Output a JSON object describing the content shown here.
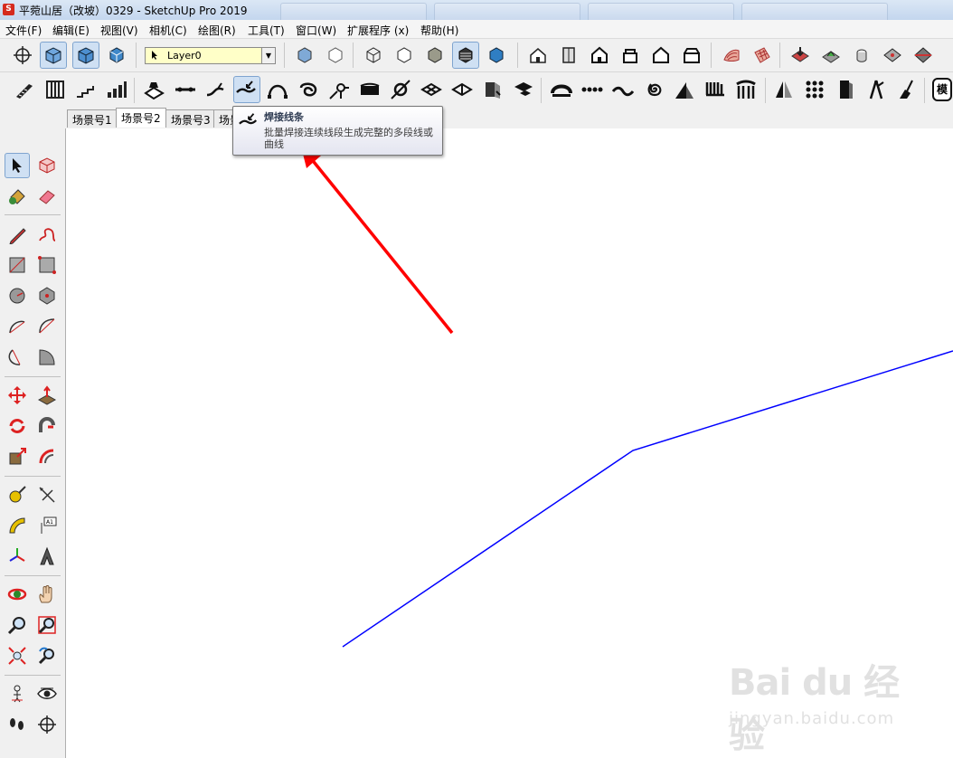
{
  "window": {
    "title": "平菀山居（改坡）0329 - SketchUp Pro 2019"
  },
  "menu": [
    "文件(F)",
    "编辑(E)",
    "视图(V)",
    "相机(C)",
    "绘图(R)",
    "工具(T)",
    "窗口(W)",
    "扩展程序 (x)",
    "帮助(H)"
  ],
  "layer": {
    "current": "Layer0"
  },
  "scene_tabs": [
    "场景号1",
    "场景号2",
    "场景号3",
    "场景"
  ],
  "active_scene_tab": "场景号2",
  "tooltip": {
    "title": "焊接线条",
    "description": "批量焊接连续线段生成完整的多段线或曲线"
  },
  "model_button_label": "模",
  "watermark": {
    "logo": "Bai du 经验",
    "url": "jingyan.baidu.com"
  },
  "colors": {
    "line": "#0000ff",
    "annotation_arrow": "#ff0000",
    "tooltip_bg": "#f4f4fa"
  }
}
